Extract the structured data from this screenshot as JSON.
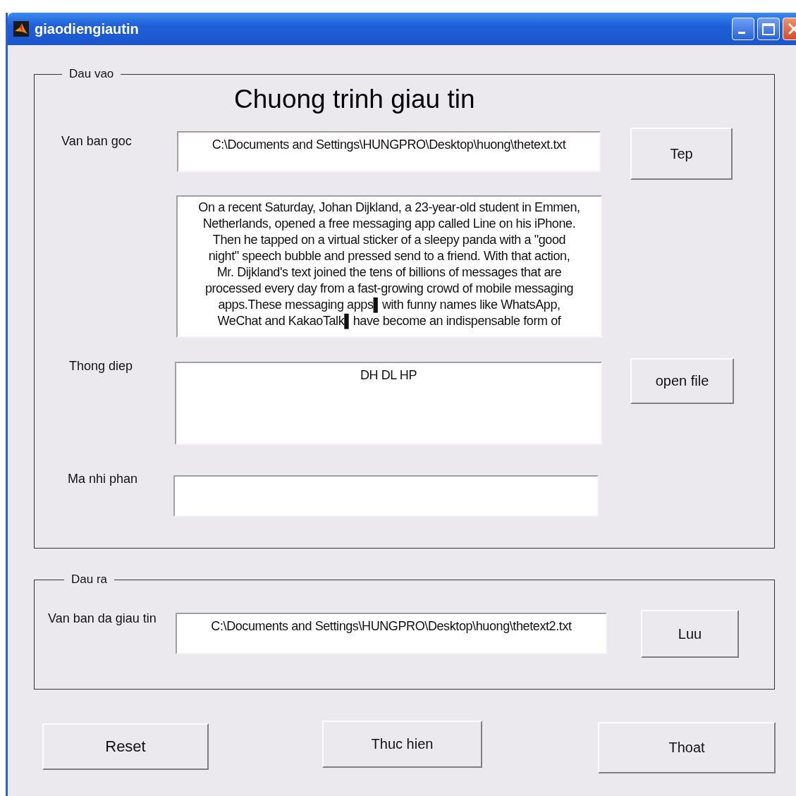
{
  "window": {
    "title": "giaodiengiautin"
  },
  "input_panel": {
    "title": "Dau vao",
    "heading": "Chuong trinh giau tin",
    "rows": [
      {
        "kind": "file",
        "label": "Van ban goc",
        "value": "C:\\Documents and Settings\\HUNGPRO\\Desktop\\huong\\thetext.txt",
        "button": "Tep"
      },
      {
        "kind": "text",
        "value": "On a recent Saturday, Johan Dijkland, a 23-year-old student in Emmen,\nNetherlands, opened a free messaging app called Line on his iPhone.\nThen he tapped on a virtual sticker of a sleepy panda with a \"good\nnight\" speech bubble and pressed send to a friend. With that action,\nMr. Dijkland's text joined the tens of billions of messages that are\nprocessed every day from a fast-growing crowd of mobile messaging\napps.These messaging apps▌with funny names like WhatsApp,\nWeChat and KakaoTalk▌have become an indispensable form of"
      },
      {
        "kind": "message",
        "label": "Thong diep",
        "value": "DH DL HP",
        "button": "open file"
      },
      {
        "kind": "binary",
        "label": "Ma nhi phan"
      }
    ]
  },
  "output_panel": {
    "title": "Dau ra",
    "label": "Van ban da giau tin",
    "value": "C:\\Documents and Settings\\HUNGPRO\\Desktop\\huong\\thetext2.txt",
    "button": "Luu"
  },
  "buttons": [
    "Reset",
    "Thuc hien",
    "Thoat"
  ]
}
